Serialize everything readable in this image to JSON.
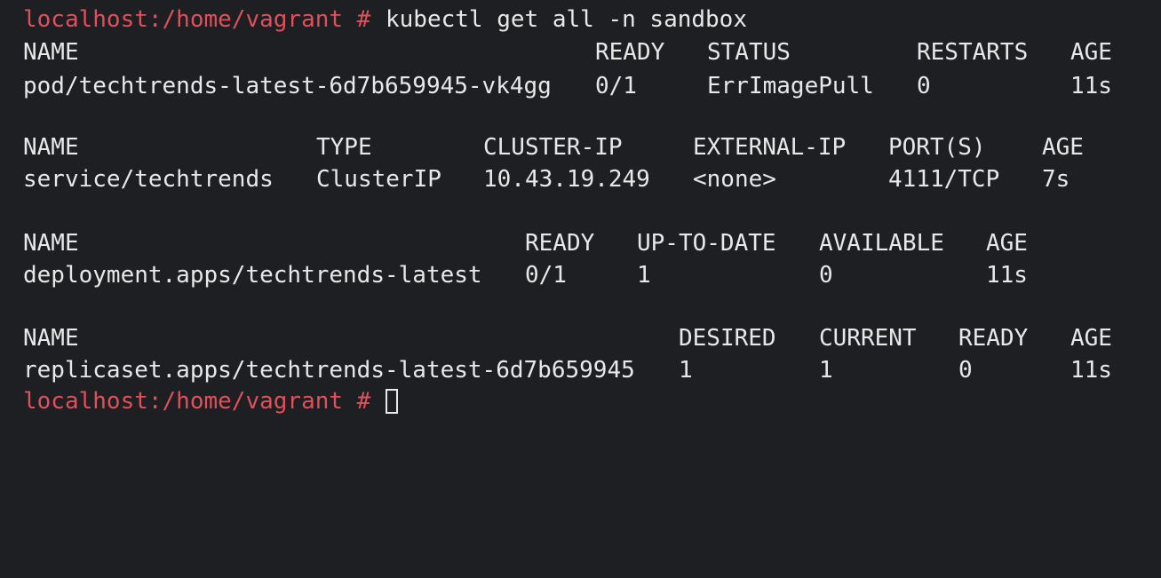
{
  "colors": {
    "background": "#1e1f22",
    "text": "#e8e8e8",
    "prompt": "#e0505a"
  },
  "prompt": "localhost:/home/vagrant #",
  "command": "kubectl get all -n sandbox",
  "pods": {
    "headers": [
      "NAME",
      "READY",
      "STATUS",
      "RESTARTS",
      "AGE"
    ],
    "rows": [
      [
        "pod/techtrends-latest-6d7b659945-vk4gg",
        "0/1",
        "ErrImagePull",
        "0",
        "11s"
      ]
    ]
  },
  "services": {
    "headers": [
      "NAME",
      "TYPE",
      "CLUSTER-IP",
      "EXTERNAL-IP",
      "PORT(S)",
      "AGE"
    ],
    "rows": [
      [
        "service/techtrends",
        "ClusterIP",
        "10.43.19.249",
        "<none>",
        "4111/TCP",
        "7s"
      ]
    ]
  },
  "deployments": {
    "headers": [
      "NAME",
      "READY",
      "UP-TO-DATE",
      "AVAILABLE",
      "AGE"
    ],
    "rows": [
      [
        "deployment.apps/techtrends-latest",
        "0/1",
        "1",
        "0",
        "11s"
      ]
    ]
  },
  "replicasets": {
    "headers": [
      "NAME",
      "DESIRED",
      "CURRENT",
      "READY",
      "AGE"
    ],
    "rows": [
      [
        "replicaset.apps/techtrends-latest-6d7b659945",
        "1",
        "1",
        "0",
        "11s"
      ]
    ]
  }
}
